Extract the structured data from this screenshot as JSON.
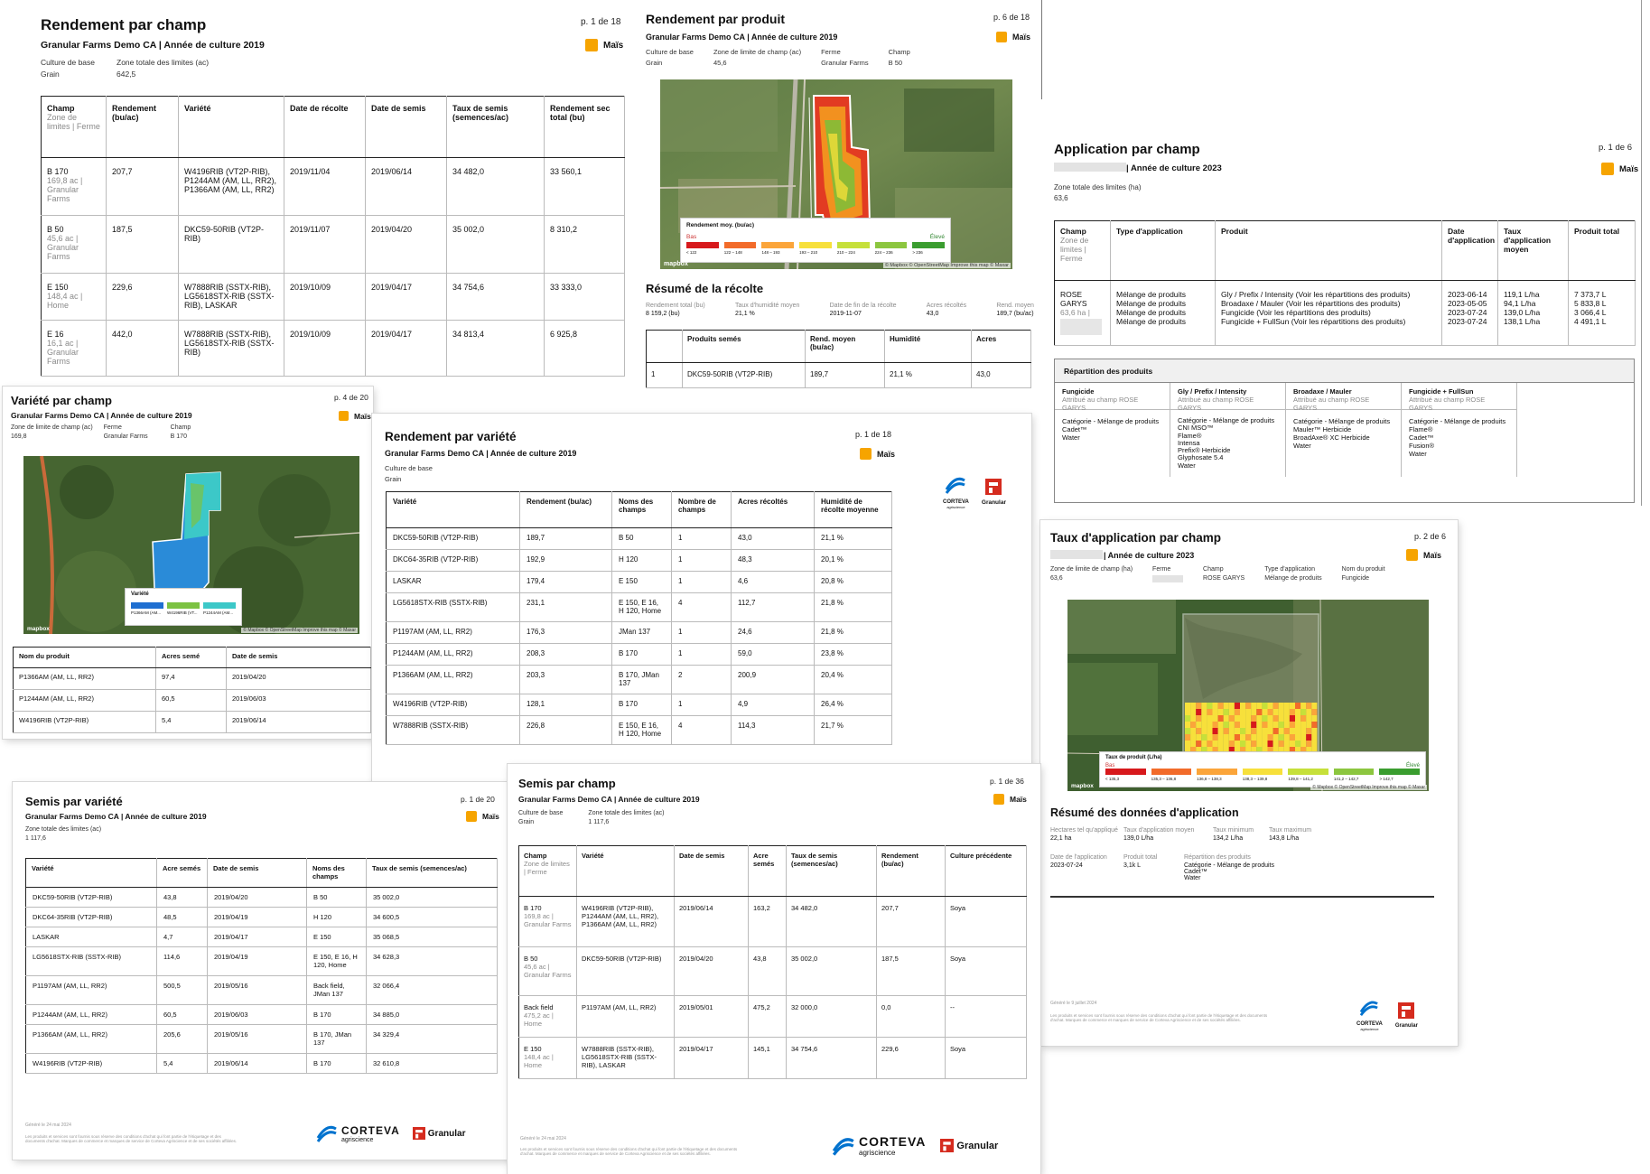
{
  "crop": "Maïs",
  "common": {
    "brand_corteva": "CORTEVA",
    "brand_corteva_sub": "agriscience",
    "brand_granular": "Granular"
  },
  "rpc": {
    "title": "Rendement par champ",
    "page": "p. 1 de 18",
    "subtitle": "Granular Farms Demo CA | Année de culture 2019",
    "meta": [
      {
        "label": "Culture de base",
        "value": "Grain"
      },
      {
        "label": "Zone totale des limites (ac)",
        "value": "642,5"
      }
    ],
    "headers": [
      {
        "main": "Champ",
        "sub": "Zone de limites | Ferme"
      },
      {
        "main": "Rendement (bu/ac)"
      },
      {
        "main": "Variété"
      },
      {
        "main": "Date de récolte"
      },
      {
        "main": "Date de semis"
      },
      {
        "main": "Taux de semis (semences/ac)"
      },
      {
        "main": "Rendement sec total (bu)"
      }
    ],
    "rows": [
      {
        "field": "B 170",
        "area": "169,8 ac | Granular Farms",
        "yield": "207,7",
        "variety": "W4196RIB (VT2P-RIB), P1244AM (AM, LL, RR2), P1366AM (AM, LL, RR2)",
        "harvest": "2019/11/04",
        "seeding": "2019/06/14",
        "rate": "34 482,0",
        "total": "33 560,1"
      },
      {
        "field": "B 50",
        "area": "45,6 ac | Granular Farms",
        "yield": "187,5",
        "variety": "DKC59-50RIB (VT2P-RIB)",
        "harvest": "2019/11/07",
        "seeding": "2019/04/20",
        "rate": "35 002,0",
        "total": "8 310,2"
      },
      {
        "field": "E 150",
        "area": "148,4 ac | Home",
        "yield": "229,6",
        "variety": "W7888RIB (SSTX-RIB), LG5618STX-RIB (SSTX-RIB), LASKAR",
        "harvest": "2019/10/09",
        "seeding": "2019/04/17",
        "rate": "34 754,6",
        "total": "33 333,0"
      },
      {
        "field": "E 16",
        "area": "16,1 ac | Granular Farms",
        "yield": "442,0",
        "variety": "W7888RIB (SSTX-RIB), LG5618STX-RIB (SSTX-RIB)",
        "harvest": "2019/10/09",
        "seeding": "2019/04/17",
        "rate": "34 813,4",
        "total": "6 925,8"
      }
    ]
  },
  "rpp": {
    "title": "Rendement par produit",
    "page": "p. 6 de 18",
    "subtitle": "Granular Farms Demo CA | Année de culture 2019",
    "meta": [
      {
        "label": "Culture de base",
        "value": "Grain"
      },
      {
        "label": "Zone de limite de champ (ac)",
        "value": "45,6"
      },
      {
        "label": "Ferme",
        "value": "Granular Farms"
      },
      {
        "label": "Champ",
        "value": "B 50"
      }
    ],
    "legend_title": "Rendement moy. (bu/ac)",
    "legend_lo": "Bas",
    "legend_hi": "Élevé",
    "legend_ranges": [
      "< 122",
      "122 – 148",
      "148 – 193",
      "193 – 210",
      "210 – 224",
      "224 – 236",
      "> 236"
    ],
    "legend_colors": [
      "#d7191c",
      "#f26b2a",
      "#fba53a",
      "#f7e03b",
      "#c6e03a",
      "#8cc63f",
      "#3a9d2f"
    ],
    "attrib": "© Mapbox © OpenStreetMap Improve this map © Maxar",
    "mapbox": "mapbox",
    "summary_title": "Résumé de la récolte",
    "summary": [
      {
        "label": "Rendement total (bu)",
        "value": "8 159,2 (bu)"
      },
      {
        "label": "Taux d'humidité moyen",
        "value": "21,1 %"
      },
      {
        "label": "Date de fin de la récolte",
        "value": "2019-11-07"
      },
      {
        "label": "Acres récoltés",
        "value": "43,0"
      },
      {
        "label": "Rend. moyen",
        "value": "189,7 (bu/ac)"
      }
    ],
    "headers": [
      "",
      "Produits semés",
      "Rend. moyen (bu/ac)",
      "Humidité",
      "Acres"
    ],
    "rows": [
      [
        "1",
        "DKC59-50RIB (VT2P-RIB)",
        "189,7",
        "21,1 %",
        "43,0"
      ]
    ]
  },
  "apc": {
    "title": "Application par champ",
    "page": "p. 1 de 6",
    "subtitle": "| Année de culture 2023",
    "meta": [
      {
        "label": "Zone totale des limites (ha)",
        "value": "63,6"
      }
    ],
    "headers": [
      {
        "main": "Champ",
        "sub": "Zone de limites | Ferme"
      },
      {
        "main": "Type d'application"
      },
      {
        "main": "Produit"
      },
      {
        "main": "Date d'application"
      },
      {
        "main": "Taux d'application moyen"
      },
      {
        "main": "Produit total"
      }
    ],
    "row": {
      "field": "ROSE GARYS",
      "area": "63,6 ha |",
      "types": [
        "Mélange de produits",
        "Mélange de produits",
        "Mélange de produits",
        "Mélange de produits"
      ],
      "products": [
        "Gly / Prefix / Intensity (Voir les répartitions des produits)",
        "Broadaxe / Mauler (Voir les répartitions des produits)",
        "Fungicide (Voir les répartitions des produits)",
        "Fungicide + FullSun (Voir les répartitions des produits)"
      ],
      "dates": [
        "2023-06-14",
        "2023-05-05",
        "2023-07-24",
        "2023-07-24"
      ],
      "rates": [
        "119,1 L/ha",
        "94,1 L/ha",
        "139,0 L/ha",
        "138,1 L/ha"
      ],
      "totals": [
        "7 373,7 L",
        "5 833,8 L",
        "3 066,4 L",
        "4 491,1 L"
      ]
    },
    "breakdown_title": "Répartition des produits",
    "breakdown": [
      {
        "name": "Fungicide",
        "attrib": "Attribué au champ ROSE GARYS",
        "items": [
          "Catégorie - Mélange de produits",
          "Cadet™",
          "Water"
        ]
      },
      {
        "name": "Gly / Prefix / Intensity",
        "attrib": "Attribué au champ ROSE GARYS",
        "items": [
          "Catégorie - Mélange de produits",
          "CNI MSO™",
          "Flame®",
          "Intensa",
          "Prefix® Herbicide",
          "Glyphosate 5.4",
          "Water"
        ]
      },
      {
        "name": "Broadaxe / Mauler",
        "attrib": "Attribué au champ ROSE GARYS",
        "items": [
          "Catégorie - Mélange de produits",
          "Mauler™ Herbicide",
          "BroadAxe® XC Herbicide",
          "Water"
        ]
      },
      {
        "name": "Fungicide + FullSun",
        "attrib": "Attribué au champ ROSE GARYS",
        "items": [
          "Catégorie - Mélange de produits",
          "Flame®",
          "Cadet™",
          "Fusion®",
          "Water"
        ]
      }
    ]
  },
  "vpc": {
    "title": "Variété par champ",
    "page": "p. 4 de 20",
    "subtitle": "Granular Farms Demo CA | Année de culture 2019",
    "meta": [
      {
        "label": "Zone de limite de champ (ac)",
        "value": "169,8"
      },
      {
        "label": "Ferme",
        "value": "Granular Farms"
      },
      {
        "label": "Champ",
        "value": "B 170"
      }
    ],
    "legend_title": "Variété",
    "legend_items": [
      {
        "label": "P1366AM (AM...",
        "color": "#1f6fd1"
      },
      {
        "label": "W4196RIB (VT...",
        "color": "#7cc242"
      },
      {
        "label": "P1244AM (AM...",
        "color": "#3cc8c8"
      }
    ],
    "attrib": "© Mapbox © OpenStreetMap Improve this map © Maxar",
    "mapbox": "mapbox",
    "headers": [
      "Nom du produit",
      "Acres semé",
      "Date de semis"
    ],
    "rows": [
      [
        "P1366AM (AM, LL, RR2)",
        "97,4",
        "2019/04/20"
      ],
      [
        "P1244AM (AM, LL, RR2)",
        "60,5",
        "2019/06/03"
      ],
      [
        "W4196RIB (VT2P-RIB)",
        "5,4",
        "2019/06/14"
      ]
    ]
  },
  "rpv": {
    "title": "Rendement par variété",
    "page": "p. 1 de 18",
    "subtitle": "Granular Farms Demo CA | Année de culture 2019",
    "meta": [
      {
        "label": "Culture de base",
        "value": "Grain"
      }
    ],
    "headers": [
      "Variété",
      "Rendement (bu/ac)",
      "Noms des champs",
      "Nombre de champs",
      "Acres récoltés",
      "Humidité de récolte moyenne"
    ],
    "rows": [
      [
        "DKC59-50RIB (VT2P-RIB)",
        "189,7",
        "B 50",
        "1",
        "43,0",
        "21,1 %"
      ],
      [
        "DKC64-35RIB (VT2P-RIB)",
        "192,9",
        "H 120",
        "1",
        "48,3",
        "20,1 %"
      ],
      [
        "LASKAR",
        "179,4",
        "E 150",
        "1",
        "4,6",
        "20,8 %"
      ],
      [
        "LG5618STX-RIB (SSTX-RIB)",
        "231,1",
        "E 150, E 16, H 120, Home",
        "4",
        "112,7",
        "21,8 %"
      ],
      [
        "P1197AM (AM, LL, RR2)",
        "176,3",
        "JMan 137",
        "1",
        "24,6",
        "21,8 %"
      ],
      [
        "P1244AM (AM, LL, RR2)",
        "208,3",
        "B 170",
        "1",
        "59,0",
        "23,8 %"
      ],
      [
        "P1366AM (AM, LL, RR2)",
        "203,3",
        "B 170, JMan 137",
        "2",
        "200,9",
        "20,4 %"
      ],
      [
        "W4196RIB (VT2P-RIB)",
        "128,1",
        "B 170",
        "1",
        "4,9",
        "26,4 %"
      ],
      [
        "W7888RIB (SSTX-RIB)",
        "226,8",
        "E 150, E 16, H 120, Home",
        "4",
        "114,3",
        "21,7 %"
      ]
    ]
  },
  "tac": {
    "title": "Taux d'application par champ",
    "page": "p. 2 de 6",
    "subtitle": "| Année de culture 2023",
    "meta": [
      {
        "label": "Zone de limite de champ (ha)",
        "value": "63,6"
      },
      {
        "label": "Ferme",
        "value": ""
      },
      {
        "label": "Champ",
        "value": "ROSE GARYS"
      },
      {
        "label": "Type d'application",
        "value": "Mélange de produits"
      },
      {
        "label": "Nom du produit",
        "value": "Fungicide"
      }
    ],
    "legend_title": "Taux de produit (L/ha)",
    "legend_lo": "Bas",
    "legend_hi": "Élevé",
    "legend_ranges": [
      "< 135,3",
      "135,3 – 136,8",
      "136,8 – 138,3",
      "138,3 – 139,8",
      "139,8 – 141,2",
      "141,2 – 142,7",
      "> 142,7"
    ],
    "legend_colors": [
      "#d7191c",
      "#f26b2a",
      "#fba53a",
      "#f7e03b",
      "#c6e03a",
      "#8cc63f",
      "#3a9d2f"
    ],
    "attrib": "© Mapbox © OpenStreetMap Improve this map © Maxar",
    "mapbox": "mapbox",
    "summary_title": "Résumé des données d'application",
    "summary1": [
      {
        "label": "Hectares tel qu'appliqué",
        "value": "22,1 ha"
      },
      {
        "label": "Taux d'application moyen",
        "value": "139,0 L/ha"
      },
      {
        "label": "Taux minimum",
        "value": "134,2 L/ha"
      },
      {
        "label": "Taux maximum",
        "value": "143,8 L/ha"
      }
    ],
    "summary2": [
      {
        "label": "Date de l'application",
        "value": "2023-07-24"
      },
      {
        "label": "Produit total",
        "value": "3,1k L"
      }
    ],
    "breakdown_label": "Répartition des produits",
    "breakdown_items": [
      "Catégorie - Mélange de produits",
      "Cadet™",
      "Water"
    ],
    "generated": "Généré le 9 juillet 2024",
    "disclaimer": "Les produits et services sont fournis sous réserve des conditions d'achat qui font partie de l'étiquetage et des documents d'achat. Marques de commerce et marques de service de Corteva Agriscience et de ses sociétés affiliées."
  },
  "spv": {
    "title": "Semis par variété",
    "page": "p. 1 de 20",
    "subtitle": "Granular Farms Demo CA | Année de culture 2019",
    "meta": [
      {
        "label": "Zone totale des limites (ac)",
        "value": "1 117,6"
      }
    ],
    "headers": [
      "Variété",
      "Acre semés",
      "Date de semis",
      "Noms des champs",
      "Taux de semis (semences/ac)"
    ],
    "rows": [
      [
        "DKC59-50RIB (VT2P-RIB)",
        "43,8",
        "2019/04/20",
        "B 50",
        "35 002,0"
      ],
      [
        "DKC64-35RIB (VT2P-RIB)",
        "48,5",
        "2019/04/19",
        "H 120",
        "34 600,5"
      ],
      [
        "LASKAR",
        "4,7",
        "2019/04/17",
        "E 150",
        "35 068,5"
      ],
      [
        "LG5618STX-RIB (SSTX-RIB)",
        "114,6",
        "2019/04/19",
        "E 150, E 16, H 120, Home",
        "34 628,3"
      ],
      [
        "P1197AM (AM, LL, RR2)",
        "500,5",
        "2019/05/16",
        "Back field, JMan 137",
        "32 066,4"
      ],
      [
        "P1244AM (AM, LL, RR2)",
        "60,5",
        "2019/06/03",
        "B 170",
        "34 885,0"
      ],
      [
        "P1366AM (AM, LL, RR2)",
        "205,6",
        "2019/05/16",
        "B 170, JMan 137",
        "34 329,4"
      ],
      [
        "W4196RIB (VT2P-RIB)",
        "5,4",
        "2019/06/14",
        "B 170",
        "32 610,8"
      ]
    ],
    "generated": "Généré le 24 mai 2024",
    "disclaimer": "Les produits et services sont fournis sous réserve des conditions d'achat qui font partie de l'étiquetage et des documents d'achat. Marques de commerce et marques de service de Corteva Agriscience et de ses sociétés affiliées."
  },
  "spc": {
    "title": "Semis par champ",
    "page": "p. 1 de 36",
    "subtitle": "Granular Farms Demo CA | Année de culture 2019",
    "meta": [
      {
        "label": "Culture de base",
        "value": "Grain"
      },
      {
        "label": "Zone totale des limites (ac)",
        "value": "1 117,6"
      }
    ],
    "headers": [
      {
        "main": "Champ",
        "sub": "Zone de limites | Ferme"
      },
      {
        "main": "Variété"
      },
      {
        "main": "Date de semis"
      },
      {
        "main": "Acre semés"
      },
      {
        "main": "Taux de semis (semences/ac)"
      },
      {
        "main": "Rendement (bu/ac)"
      },
      {
        "main": "Culture précédente"
      }
    ],
    "rows": [
      {
        "field": "B 170",
        "area": "169,8 ac | Granular Farms",
        "variety": "W4196RIB (VT2P-RIB), P1244AM (AM, LL, RR2), P1366AM (AM, LL, RR2)",
        "date": "2019/06/14",
        "acres": "163,2",
        "rate": "34 482,0",
        "yield": "207,7",
        "prev": "Soya"
      },
      {
        "field": "B 50",
        "area": "45,6 ac | Granular Farms",
        "variety": "DKC59-50RIB (VT2P-RIB)",
        "date": "2019/04/20",
        "acres": "43,8",
        "rate": "35 002,0",
        "yield": "187,5",
        "prev": "Soya"
      },
      {
        "field": "Back field",
        "area": "475,2 ac | Home",
        "variety": "P1197AM (AM, LL, RR2)",
        "date": "2019/05/01",
        "acres": "475,2",
        "rate": "32 000,0",
        "yield": "0,0",
        "prev": "--"
      },
      {
        "field": "E 150",
        "area": "148,4 ac | Home",
        "variety": "W7888RIB (SSTX-RIB), LG5618STX-RIB (SSTX-RIB), LASKAR",
        "date": "2019/04/17",
        "acres": "145,1",
        "rate": "34 754,6",
        "yield": "229,6",
        "prev": "Soya"
      }
    ],
    "generated": "Généré le 24 mai 2024",
    "disclaimer": "Les produits et services sont fournis sous réserve des conditions d'achat qui font partie de l'étiquetage et des documents d'achat. Marques de commerce et marques de service de Corteva Agriscience et de ses sociétés affiliées."
  }
}
